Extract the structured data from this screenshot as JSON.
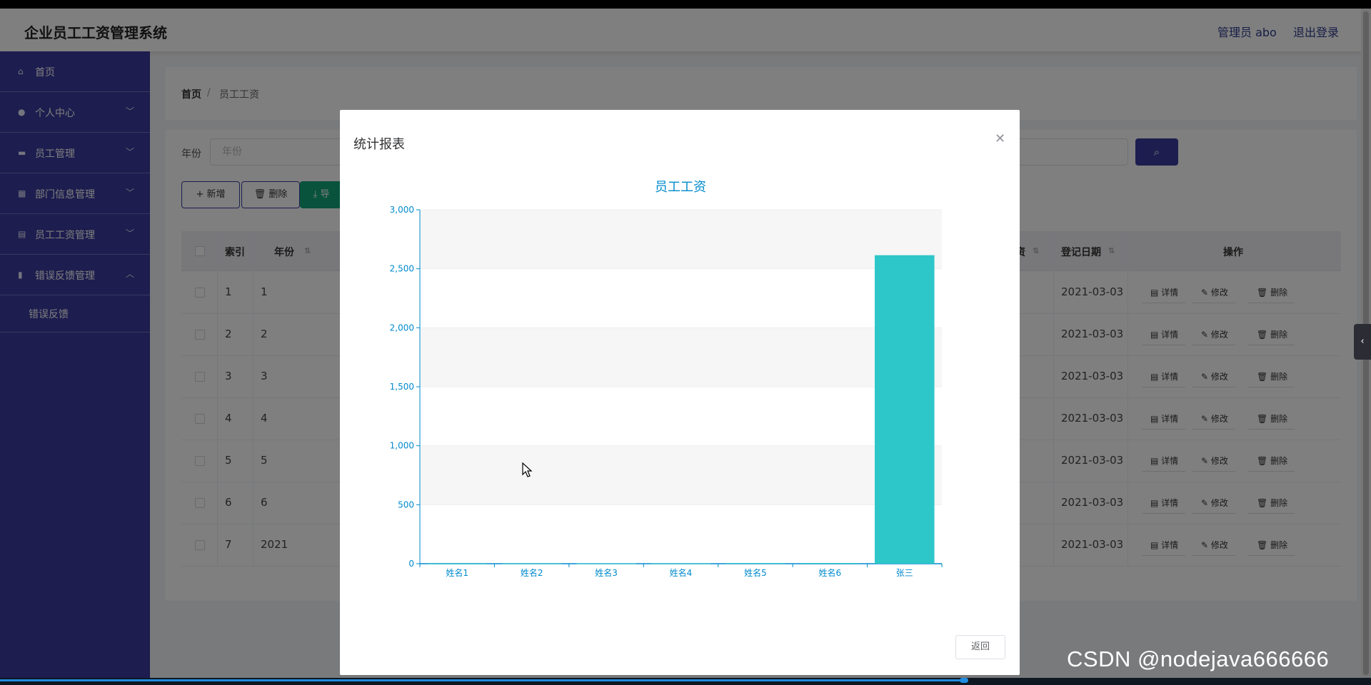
{
  "header": {
    "title": "企业员工工资管理系统",
    "admin": "管理员 abo",
    "logout": "退出登录"
  },
  "sidebar": {
    "items": [
      {
        "label": "首页",
        "icon": "home-icon"
      },
      {
        "label": "个人中心",
        "icon": "user-icon"
      },
      {
        "label": "员工管理",
        "icon": "monitor-icon"
      },
      {
        "label": "部门信息管理",
        "icon": "grid-icon"
      },
      {
        "label": "员工工资管理",
        "icon": "storage-icon"
      },
      {
        "label": "错误反馈管理",
        "icon": "clipboard-icon"
      }
    ],
    "sub_item": "错误反馈"
  },
  "breadcrumb": {
    "home": "首页",
    "sep": "/",
    "current": "员工工资"
  },
  "search": {
    "year_label": "年份",
    "year_placeholder": "年份"
  },
  "toolbar": {
    "add": "+ 新增",
    "delete": "删除",
    "export": "导"
  },
  "table": {
    "headers": {
      "index": "索引",
      "year": "年份",
      "salary": "资",
      "date": "登记日期",
      "ops": "操作"
    },
    "rows": [
      {
        "index": "1",
        "year": "1",
        "date": "2021-03-03"
      },
      {
        "index": "2",
        "year": "2",
        "date": "2021-03-03"
      },
      {
        "index": "3",
        "year": "3",
        "date": "2021-03-03"
      },
      {
        "index": "4",
        "year": "4",
        "date": "2021-03-03"
      },
      {
        "index": "5",
        "year": "5",
        "date": "2021-03-03"
      },
      {
        "index": "6",
        "year": "6",
        "date": "2021-03-03"
      },
      {
        "index": "7",
        "year": "2021",
        "date": "2021-03-03"
      }
    ],
    "ops": {
      "detail": "详情",
      "edit": "修改",
      "delete": "删除"
    }
  },
  "modal": {
    "title": "统计报表",
    "back": "返回"
  },
  "chart_data": {
    "type": "bar",
    "title": "员工工资",
    "categories": [
      "姓名1",
      "姓名2",
      "姓名3",
      "姓名4",
      "姓名5",
      "姓名6",
      "张三"
    ],
    "values": [
      1,
      2,
      3,
      4,
      5,
      6,
      2615
    ],
    "yticks": [
      "0",
      "500",
      "1,000",
      "1,500",
      "2,000",
      "2,500",
      "3,000"
    ],
    "ylim": [
      0,
      3000
    ],
    "grid": true,
    "colors": {
      "bar": "#2ec7c9",
      "axis": "#008acd",
      "title": "#008acd"
    }
  },
  "watermark": "CSDN @nodejava666666"
}
